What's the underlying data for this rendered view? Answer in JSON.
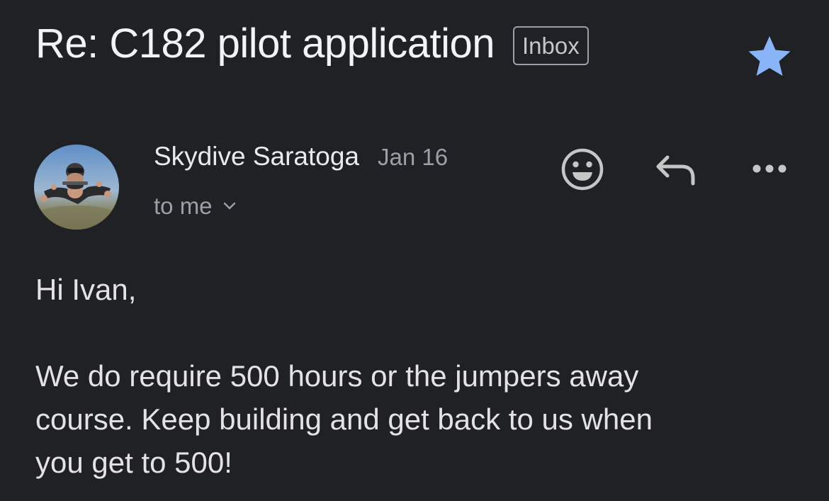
{
  "email": {
    "subject": "Re: C182 pilot application",
    "label": "Inbox",
    "starred": true,
    "sender_name": "Skydive Saratoga",
    "date": "Jan 16",
    "recipient": "to me",
    "greeting": "Hi Ivan,",
    "body_text": "We do require 500 hours or the jumpers away\ncourse. Keep building and get back to us when\nyou get to 500!"
  },
  "icons": {
    "star": "star-icon",
    "avatar": "tandem-skydive-photo",
    "emoji": "emoji-reaction-icon",
    "reply": "reply-arrow-icon",
    "more": "more-horizontal-icon",
    "recipient_details": "chevron-down-icon"
  },
  "colors": {
    "background": "#202124",
    "star": "#8ab4f8",
    "primary_text": "#f1f3f4",
    "secondary_text": "#9aa0a6"
  }
}
